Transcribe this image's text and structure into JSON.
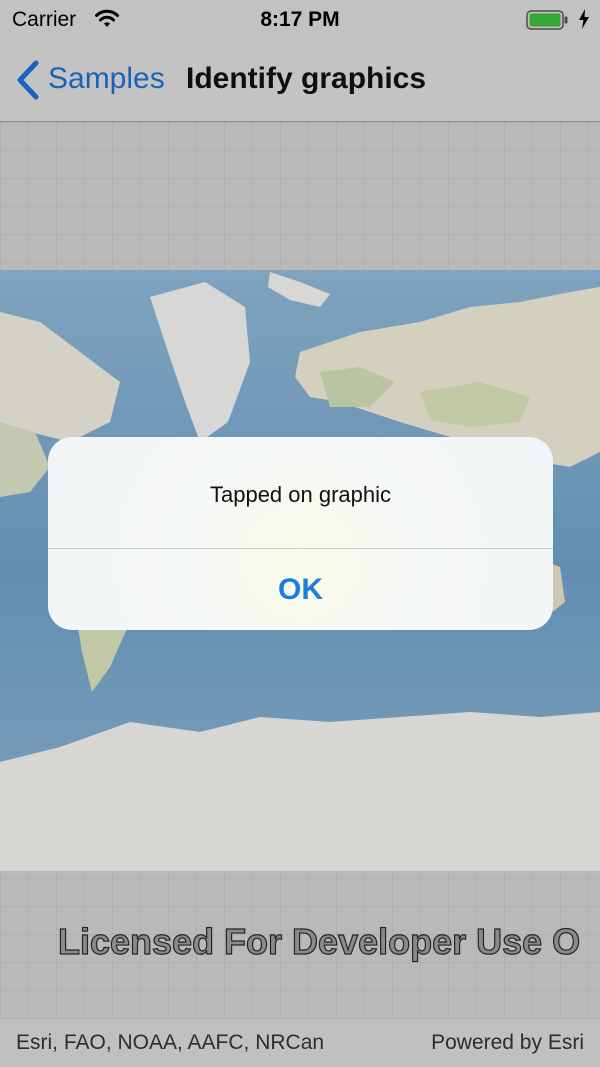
{
  "status_bar": {
    "carrier": "Carrier",
    "time": "8:17 PM",
    "battery_color": "#3dbb3d"
  },
  "nav_bar": {
    "back_label": "Samples",
    "title": "Identify graphics",
    "accent_color": "#1f6ecf"
  },
  "map": {
    "watermark": "Licensed For Developer Use O"
  },
  "attribution": {
    "sources": "Esri, FAO, NOAA, AAFC, NRCan",
    "powered_by": "Powered by Esri"
  },
  "alert": {
    "message": "Tapped on graphic",
    "ok_label": "OK"
  }
}
